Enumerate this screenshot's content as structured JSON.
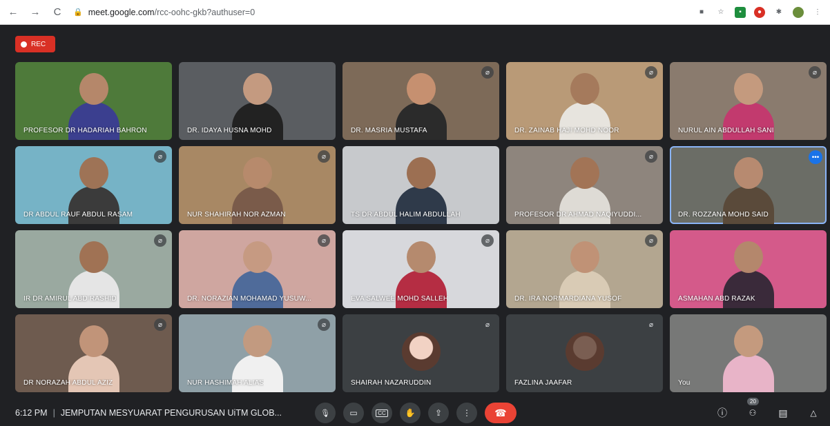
{
  "browser": {
    "url_host": "meet.google.com",
    "url_path": "/rcc-oohc-gkb?authuser=0"
  },
  "recording": {
    "label": "REC"
  },
  "participants": [
    {
      "name": "PROFESOR DR HADARIAH BAHRON",
      "muted": false,
      "bg": "#4e7a3a",
      "skin": "#b5876a",
      "cloth": "#3b3f8f"
    },
    {
      "name": "DR. IDAYA HUSNA MOHD",
      "muted": false,
      "bg": "#5a5d61",
      "skin": "#c49a80",
      "cloth": "#222222"
    },
    {
      "name": "DR. MASRIA MUSTAFA",
      "muted": true,
      "bg": "#7d6a58",
      "skin": "#c69070",
      "cloth": "#2b2b2b"
    },
    {
      "name": "DR. ZAINAB HAJI MOHD NOOR",
      "muted": true,
      "bg": "#b99a77",
      "skin": "#a57a5c",
      "cloth": "#e7e4de"
    },
    {
      "name": "NURUL AIN ABDULLAH SANI",
      "muted": true,
      "bg": "#8a7b6e",
      "skin": "#c49a7e",
      "cloth": "#c23a6e"
    },
    {
      "name": "DR ABDUL RAUF ABDUL RASAM",
      "muted": true,
      "bg": "#76b3c6",
      "skin": "#9e7356",
      "cloth": "#3b3b3b"
    },
    {
      "name": "NUR SHAHIRAH NOR AZMAN",
      "muted": true,
      "bg": "#a88864",
      "skin": "#b78a6c",
      "cloth": "#7a5b4a"
    },
    {
      "name": "TS DR ABDUL HALIM ABDULLAH",
      "muted": false,
      "bg": "#c7c9cc",
      "skin": "#9c6f52",
      "cloth": "#2f3a4a"
    },
    {
      "name": "PROFESOR DR AHMAD NAQIYUDDI...",
      "muted": true,
      "bg": "#8e857d",
      "skin": "#a27456",
      "cloth": "#dedbd5"
    },
    {
      "name": "DR. ROZZANA MOHD SAID",
      "muted": false,
      "bg": "#6b6d66",
      "skin": "#b78a70",
      "cloth": "#5a4a3a"
    },
    {
      "name": "IR DR AMIRUL ABD RASHID",
      "muted": true,
      "bg": "#9aa9a0",
      "skin": "#a07254",
      "cloth": "#e5e5e5"
    },
    {
      "name": "DR. NORAZIAN MOHAMAD YUSUW...",
      "muted": true,
      "bg": "#cfa6a0",
      "skin": "#c69a82",
      "cloth": "#4f6b9a"
    },
    {
      "name": "EVA SALWEE MOHD SALLEH",
      "muted": true,
      "bg": "#d7d8dc",
      "skin": "#b58a6e",
      "cloth": "#b52d43"
    },
    {
      "name": "DR. IRA NORMARDIANA YUSOF",
      "muted": true,
      "bg": "#b3a690",
      "skin": "#c09276",
      "cloth": "#d9cbb5"
    },
    {
      "name": "ASMAHAN ABD RAZAK",
      "muted": false,
      "bg": "#d45a8a",
      "skin": "#b4876c",
      "cloth": "#3a2a3a"
    },
    {
      "name": "DR NORAZAH ABDUL AZIZ",
      "muted": true,
      "bg": "#6e5b4f",
      "skin": "#c19479",
      "cloth": "#e4c6b5"
    },
    {
      "name": "NUR HASHIMAH ALIAS",
      "muted": true,
      "bg": "#8fa0a7",
      "skin": "#c29a80",
      "cloth": "#f0f0f0"
    },
    {
      "name": "SHAIRAH NAZARUDDIN",
      "muted": true,
      "bg": "#3c4043",
      "avatar": true,
      "skin": "#f2d2c4",
      "cloth": "#f2d2c4"
    },
    {
      "name": "FAZLINA JAAFAR",
      "muted": true,
      "bg": "#3c4043",
      "avatar": true,
      "skin": "#7a5e52",
      "cloth": "#7a5e52"
    },
    {
      "name": "You",
      "muted": false,
      "bg": "#777877",
      "skin": "#c49a7e",
      "cloth": "#e8b4c8"
    }
  ],
  "active_tile_index": 9,
  "footer": {
    "time": "6:12 PM",
    "separator": "|",
    "meeting_title": "JEMPUTAN MESYUARAT PENGURUSAN UiTM GLOB...",
    "people_count": "20"
  },
  "icons": {
    "back": "←",
    "forward": "→",
    "reload": "C",
    "lock": "🔒",
    "mic": "🎙",
    "camera": "▭",
    "captions": "CC",
    "hand": "✋",
    "present": "⇪",
    "more": "⋮",
    "end": "☎",
    "info": "ⓘ",
    "people": "👥",
    "chat": "▤",
    "activities": "⚲"
  }
}
